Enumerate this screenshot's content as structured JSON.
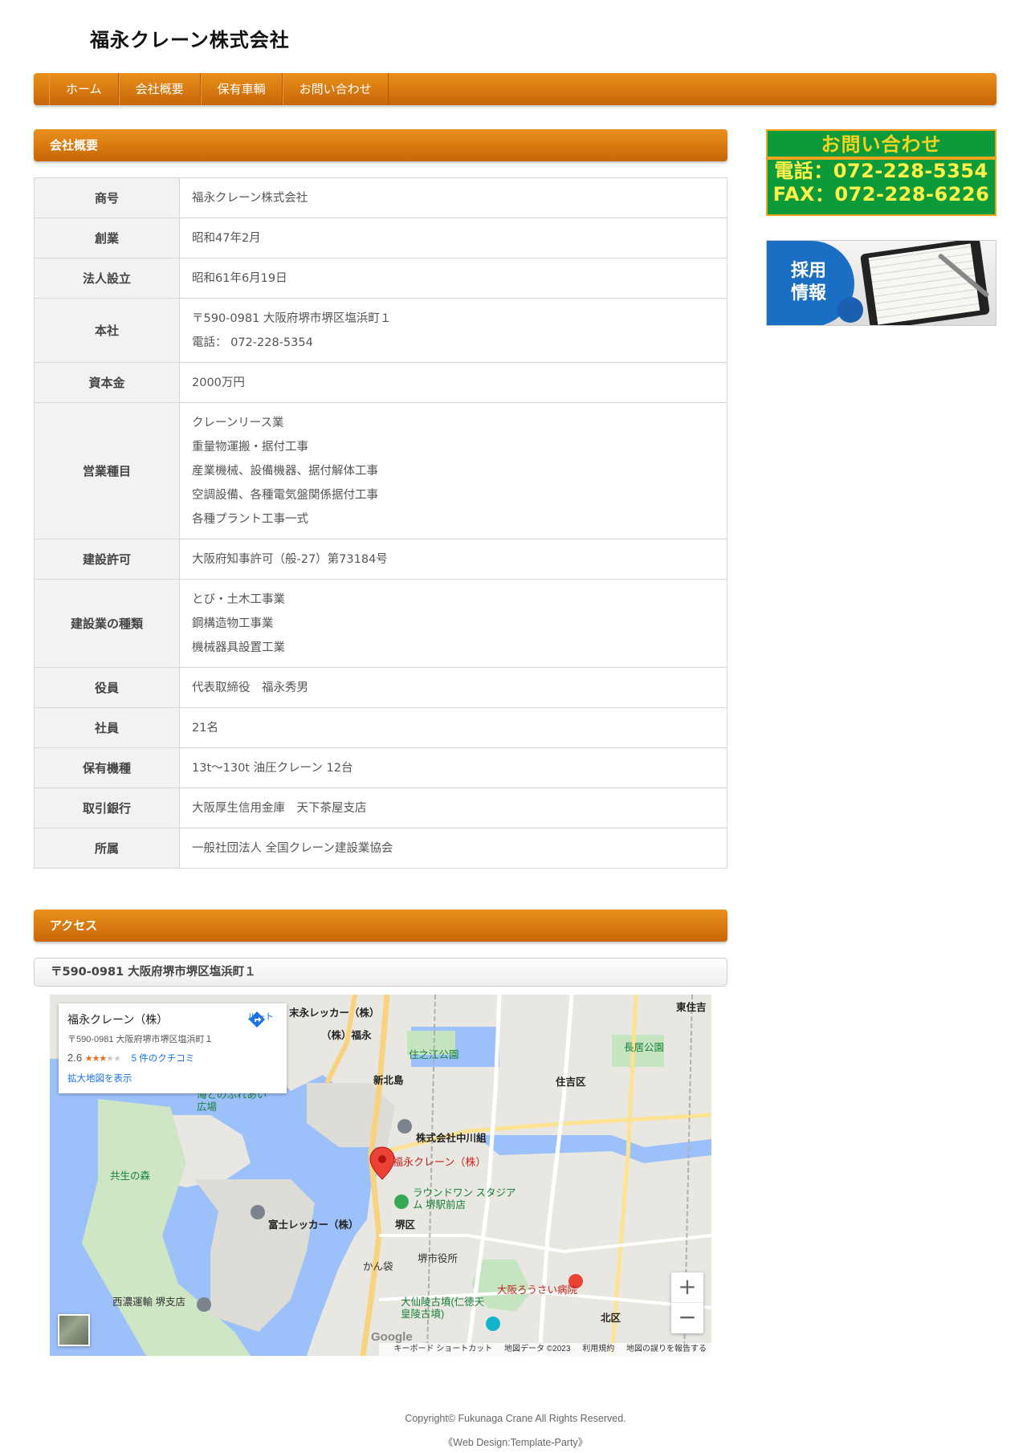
{
  "site": {
    "title": "福永クレーン株式会社"
  },
  "nav": {
    "items": [
      "ホーム",
      "会社概要",
      "保有車輌",
      "お問い合わせ"
    ]
  },
  "company": {
    "heading": "会社概要",
    "rows": [
      {
        "label": "商号",
        "lines": [
          "福永クレーン株式会社"
        ]
      },
      {
        "label": "創業",
        "lines": [
          "昭和47年2月"
        ]
      },
      {
        "label": "法人設立",
        "lines": [
          "昭和61年6月19日"
        ]
      },
      {
        "label": "本社",
        "lines": [
          "〒590-0981 大阪府堺市堺区塩浜町１",
          "電話： 072-228-5354"
        ]
      },
      {
        "label": "資本金",
        "lines": [
          "2000万円"
        ]
      },
      {
        "label": "営業種目",
        "lines": [
          "クレーンリース業",
          "重量物運搬・据付工事",
          "産業機械、設備機器、据付解体工事",
          "空調設備、各種電気盤関係据付工事",
          "各種プラント工事一式"
        ]
      },
      {
        "label": "建設許可",
        "lines": [
          "大阪府知事許可（般-27）第73184号"
        ]
      },
      {
        "label": "建設業の種類",
        "lines": [
          "とび・土木工事業",
          "鋼構造物工事業",
          "機械器具設置工業"
        ]
      },
      {
        "label": "役員",
        "lines": [
          "代表取締役　福永秀男"
        ]
      },
      {
        "label": "社員",
        "lines": [
          "21名"
        ]
      },
      {
        "label": "保有機種",
        "lines": [
          "13t～130t 油圧クレーン 12台"
        ]
      },
      {
        "label": "取引銀行",
        "lines": [
          "大阪厚生信用金庫　天下茶屋支店"
        ]
      },
      {
        "label": "所属",
        "lines": [
          "一般社団法人 全国クレーン建設業協会"
        ]
      }
    ]
  },
  "access": {
    "heading": "アクセス",
    "address": "〒590-0981 大阪府堺市堺区塩浜町１",
    "map": {
      "place_name": "福永クレーン（株）",
      "place_address": "〒590-0981 大阪府堺市堺区塩浜町１",
      "rating": "2.6",
      "rating_value": 2.6,
      "reviews": "5 件のクチコミ",
      "enlarge": "拡大地図を表示",
      "route": "ルート",
      "zoom_in": "+",
      "zoom_out": "−",
      "google": "Google",
      "attribution": [
        "キーボード ショートカット",
        "地図データ ©2023",
        "利用規約",
        "地図の誤りを報告する"
      ],
      "labels": {
        "fukunaga": "福永クレーン（株）",
        "suenaga": "末永レッカー（株）",
        "fukuei": "（株）福永",
        "nakagawa": "株式会社中川組",
        "fuji": "富士レッカー（株）",
        "round1": "ラウンドワン スタジアム 堺駅前店",
        "sumiyoshi": "住吉区",
        "sakai": "堺区",
        "kita": "北区",
        "kyosei": "共生の森",
        "umi": "海とのふれあい広場",
        "nagai": "長居公園",
        "suminoe": "住之江公園",
        "shinkitajima": "新北島",
        "hamadera": "西濃運輸 堺支店",
        "rosai": "大阪ろうさい病院",
        "daisen": "大仙陵古墳(仁徳天皇陵古墳)",
        "higashisumiyoshi": "東住吉",
        "kasugai": "かん袋",
        "shiyakusho": "堺市役所"
      }
    }
  },
  "sidebar": {
    "contact_title": "お問い合わせ",
    "contact_tel": "電話：072-228-5354",
    "contact_fax": "FAX：072-228-6226",
    "recruit_line1": "採用",
    "recruit_line2": "情報"
  },
  "footer": {
    "copyright": "Copyright© Fukunaga Crane All Rights Reserved.",
    "design": "《Web Design:Template-Party》"
  },
  "colors": {
    "accent_orange": "#d8760f",
    "banner_green": "#0d9a3a",
    "banner_border": "#f0a41b",
    "map_pin": "#ea4335"
  }
}
